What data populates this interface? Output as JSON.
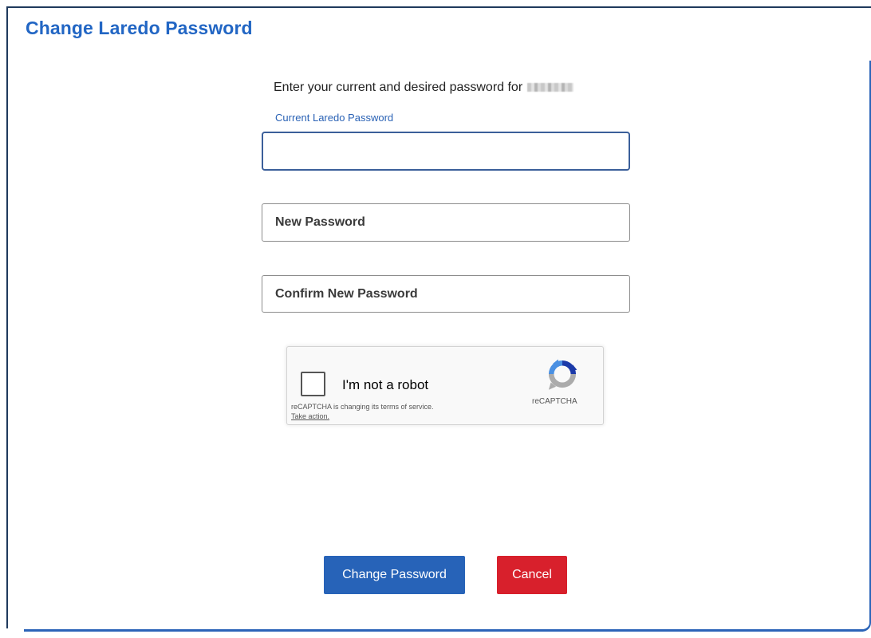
{
  "page": {
    "title": "Change Laredo Password",
    "intro": "Enter your current and desired password for"
  },
  "form": {
    "current_password": {
      "label": "Current Laredo Password",
      "value": ""
    },
    "new_password": {
      "placeholder": "New Password",
      "value": ""
    },
    "confirm_password": {
      "placeholder": "Confirm New Password",
      "value": ""
    }
  },
  "captcha": {
    "label": "I'm not a robot",
    "notice": "reCAPTCHA is changing its terms of service.",
    "take_action": "Take action.",
    "brand": "reCAPTCHA",
    "checked": false,
    "icon": "recaptcha-logo-icon"
  },
  "buttons": {
    "submit_label": "Change Password",
    "cancel_label": "Cancel"
  },
  "colors": {
    "accent": "#2266c4",
    "primary_button": "#2763b8",
    "cancel_button": "#d8202c"
  }
}
